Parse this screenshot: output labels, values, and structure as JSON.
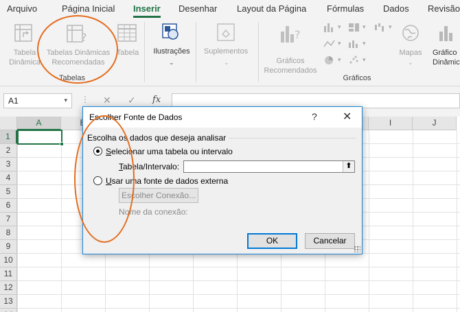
{
  "ribbon_tabs": [
    {
      "label": "Arquivo"
    },
    {
      "label": "Página Inicial"
    },
    {
      "label": "Inserir",
      "active": true
    },
    {
      "label": "Desenhar"
    },
    {
      "label": "Layout da Página"
    },
    {
      "label": "Fórmulas"
    },
    {
      "label": "Dados"
    },
    {
      "label": "Revisão"
    }
  ],
  "ribbon": {
    "tabela_dinamica": {
      "line1": "Tabela",
      "line2": "Dinâmica",
      "icon": "pivot-table-icon"
    },
    "tabelas_recomendadas": {
      "line1": "Tabelas Dinâmicas",
      "line2": "Recomendadas",
      "icon": "recommended-pivot-icon"
    },
    "tabela": {
      "label": "Tabela",
      "icon": "table-icon"
    },
    "group_tabelas": "Tabelas",
    "ilustracoes": {
      "label": "Ilustrações",
      "icon": "illustrations-icon"
    },
    "suplementos": {
      "label": "Suplementos",
      "icon": "add-ins-icon"
    },
    "graficos_recomendados": {
      "line1": "Gráficos",
      "line2": "Recomendados",
      "icon": "recommended-charts-icon"
    },
    "mapas": {
      "label": "Mapas",
      "icon": "maps-icon"
    },
    "grafico_dinamico": {
      "line1": "Gráfico",
      "line2": "Dinâmico",
      "icon": "pivot-chart-icon"
    },
    "group_graficos": "Gráficos"
  },
  "formula_bar": {
    "name_box": "A1",
    "fx": "fx",
    "value": ""
  },
  "grid": {
    "columns": [
      "A",
      "B",
      "C",
      "D",
      "E",
      "F",
      "G",
      "H",
      "I",
      "J"
    ],
    "rows": [
      "1",
      "2",
      "3",
      "4",
      "5",
      "6",
      "7",
      "8",
      "9",
      "10",
      "11",
      "12",
      "13",
      "14"
    ],
    "active_cell": "A1"
  },
  "dialog": {
    "title": "Escolher Fonte de Dados",
    "help": "?",
    "close": "✕",
    "section_label": "Escolha os dados que deseja analisar",
    "option_select_range": {
      "hot": "S",
      "rest": "elecionar uma tabela ou intervalo",
      "selected": true
    },
    "range_label": {
      "hot": "T",
      "rest": "abela/Intervalo:"
    },
    "range_value": "",
    "option_external": {
      "hot": "U",
      "rest": "sar uma fonte de dados externa",
      "selected": false
    },
    "choose_connection_button": "Escolher Conexão...",
    "connection_name_label": "Nome da conexão:",
    "ok_button": "OK",
    "cancel_button": "Cancelar"
  },
  "annotation_color": "#e46c1d",
  "accent_color": "#217346"
}
